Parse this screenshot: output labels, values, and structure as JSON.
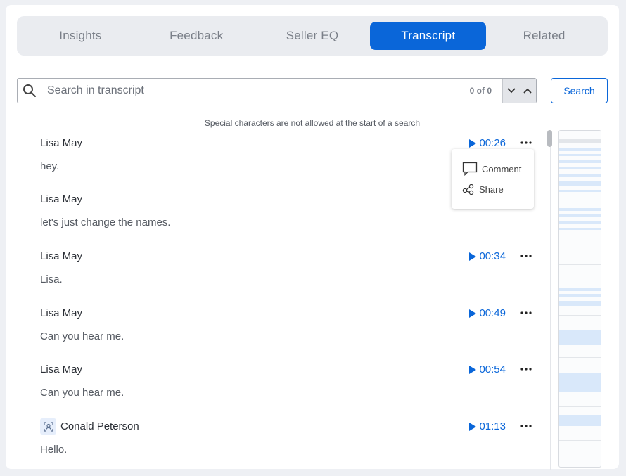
{
  "tabs": [
    {
      "label": "Insights",
      "active": false
    },
    {
      "label": "Feedback",
      "active": false
    },
    {
      "label": "Seller EQ",
      "active": false
    },
    {
      "label": "Transcript",
      "active": true
    },
    {
      "label": "Related",
      "active": false
    }
  ],
  "search": {
    "placeholder": "Search in transcript",
    "value": "",
    "count": "0 of 0",
    "button_label": "Search",
    "hint": "Special characters are not allowed at the start of a search"
  },
  "context_menu": {
    "comment_label": "Comment",
    "share_label": "Share"
  },
  "entries": [
    {
      "speaker": "Lisa May",
      "text": "hey.",
      "time": "00:26",
      "has_avatar": false
    },
    {
      "speaker": "Lisa May",
      "text": "let's just change the names.",
      "time": "",
      "has_avatar": false
    },
    {
      "speaker": "Lisa May",
      "text": "Lisa.",
      "time": "00:34",
      "has_avatar": false
    },
    {
      "speaker": "Lisa May",
      "text": "Can you hear me.",
      "time": "00:49",
      "has_avatar": false
    },
    {
      "speaker": "Lisa May",
      "text": "Can you hear me.",
      "time": "00:54",
      "has_avatar": false
    },
    {
      "speaker": "Conald Peterson",
      "text": "Hello.",
      "time": "01:13",
      "has_avatar": true
    }
  ],
  "colors": {
    "accent": "#0a66d9",
    "minimap_highlight": "#d9e8fa"
  }
}
